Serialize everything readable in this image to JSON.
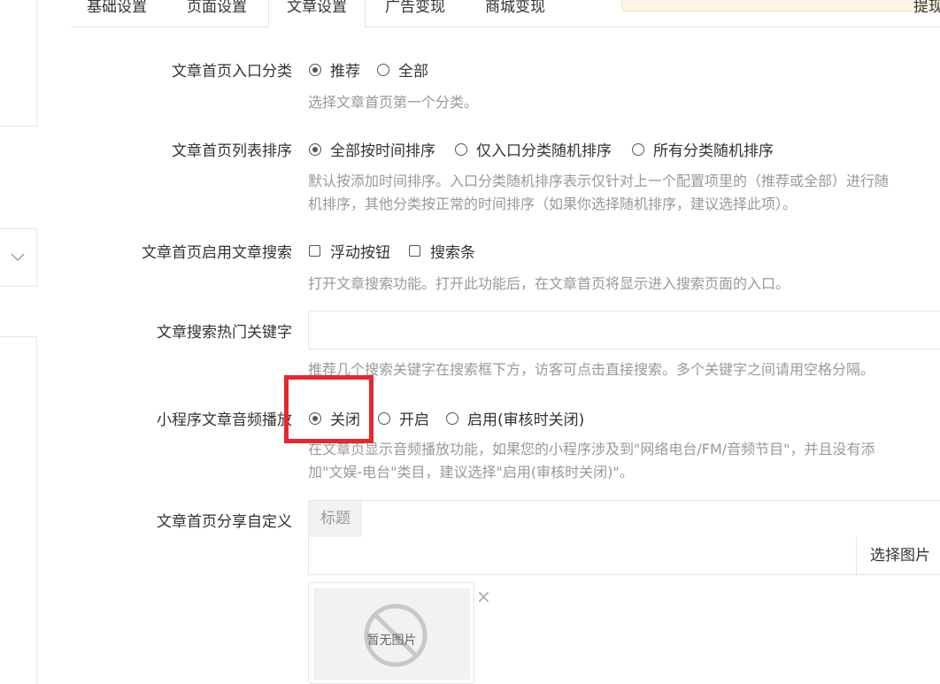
{
  "tabs": [
    {
      "label": "基础设置",
      "active": false
    },
    {
      "label": "页面设置",
      "active": false
    },
    {
      "label": "文章设置",
      "active": true
    },
    {
      "label": "广告变现",
      "active": false
    },
    {
      "label": "商城变现",
      "active": false
    },
    {
      "label": "提现",
      "active": false
    }
  ],
  "rows": {
    "entry_category": {
      "label": "文章首页入口分类",
      "options": [
        {
          "label": "推荐",
          "checked": true
        },
        {
          "label": "全部",
          "checked": false
        }
      ],
      "help": "选择文章首页第一个分类。"
    },
    "list_sort": {
      "label": "文章首页列表排序",
      "options": [
        {
          "label": "全部按时间排序",
          "checked": true
        },
        {
          "label": "仅入口分类随机排序",
          "checked": false
        },
        {
          "label": "所有分类随机排序",
          "checked": false
        }
      ],
      "help_line1": "默认按添加时间排序。入口分类随机排序表示仅针对上一个配置项里的（推荐或全部）进行随",
      "help_line2": "机排序，其他分类按正常的时间排序（如果你选择随机排序，建议选择此项）。"
    },
    "search": {
      "label": "文章首页启用文章搜索",
      "options": [
        {
          "label": "浮动按钮",
          "checked": false
        },
        {
          "label": "搜索条",
          "checked": false
        }
      ],
      "help": "打开文章搜索功能。打开此功能后，在文章首页将显示进入搜索页面的入口。"
    },
    "hot_keywords": {
      "label": "文章搜索热门关键字",
      "value": "",
      "help": "推荐几个搜索关键字在搜索框下方，访客可点击直接搜索。多个关键字之间请用空格分隔。"
    },
    "audio": {
      "label": "小程序文章音频播放",
      "options": [
        {
          "label": "关闭",
          "checked": true
        },
        {
          "label": "开启",
          "checked": false
        },
        {
          "label": "启用(审核时关闭)",
          "checked": false
        }
      ],
      "help_line1": "在文章页显示音频播放功能，如果您的小程序涉及到\"网络电台/FM/音频节目\"，并且没有添",
      "help_line2": "加\"文娱-电台\"类目，建议选择\"启用(审核时关闭)\"。"
    },
    "share": {
      "label": "文章首页分享自定义",
      "title_addon": "标题",
      "title_value": "",
      "image_value": "",
      "choose_label": "选择图片",
      "no_image_text": "暂无图片",
      "close_symbol": "×"
    }
  },
  "colors": {
    "highlight": "#e8262b",
    "tip_banner": "#fdf6e6"
  }
}
